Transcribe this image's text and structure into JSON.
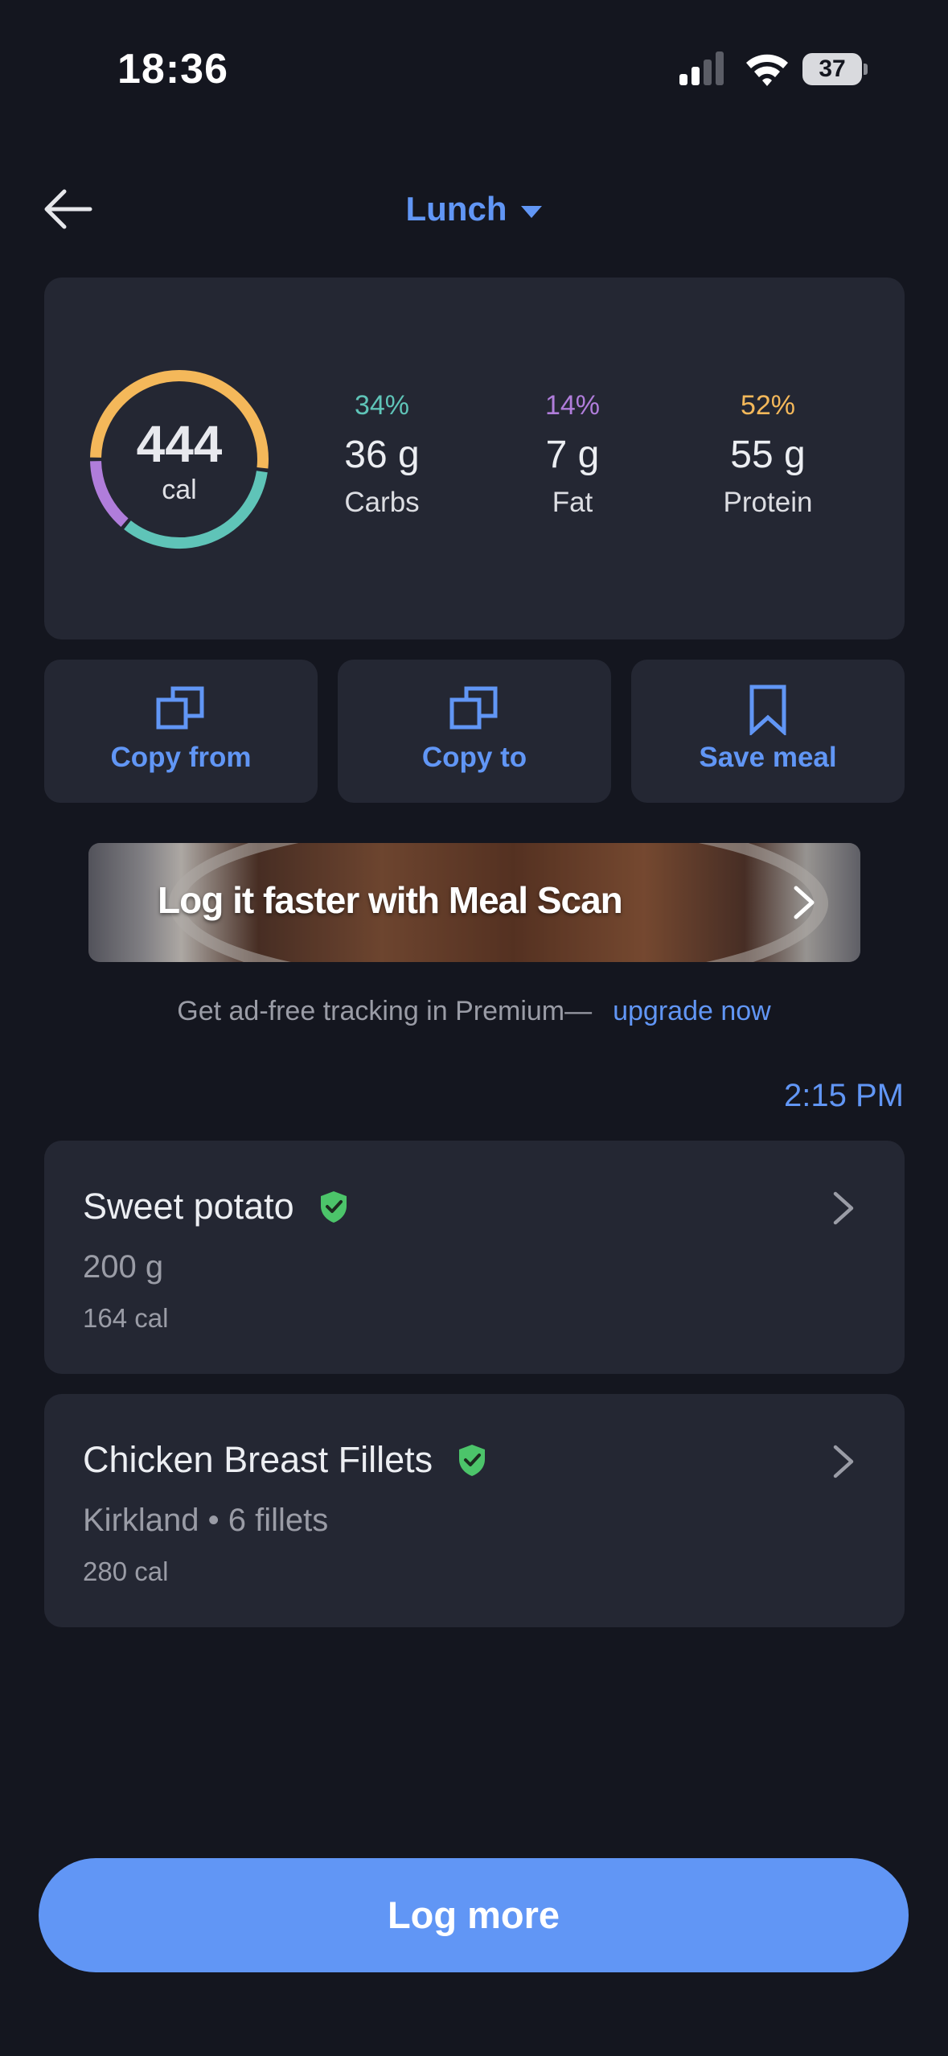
{
  "status_bar": {
    "time": "18:36",
    "battery": "37"
  },
  "header": {
    "meal": "Lunch"
  },
  "summary": {
    "calories": "444",
    "calories_unit": "cal",
    "macros": [
      {
        "pct": "34%",
        "amount": "36 g",
        "name": "Carbs",
        "color": "#5fc4b8"
      },
      {
        "pct": "14%",
        "amount": "7 g",
        "name": "Fat",
        "color": "#b07ddb"
      },
      {
        "pct": "52%",
        "amount": "55 g",
        "name": "Protein",
        "color": "#f4b85a"
      }
    ]
  },
  "actions": {
    "copy_from": "Copy from",
    "copy_to": "Copy to",
    "save_meal": "Save meal"
  },
  "banner": {
    "text": "Log it faster with Meal Scan"
  },
  "premium": {
    "text": "Get ad-free tracking in Premium—",
    "link": "upgrade now"
  },
  "log_time": "2:15 PM",
  "foods": [
    {
      "name": "Sweet potato",
      "detail": "200 g",
      "calories": "164 cal"
    },
    {
      "name": "Chicken Breast Fillets",
      "detail": "Kirkland • 6 fillets",
      "calories": "280 cal"
    }
  ],
  "log_more": "Log more",
  "colors": {
    "accent": "#6196f5",
    "background": "#14161f",
    "card": "#242733",
    "verified": "#4cc46a"
  }
}
